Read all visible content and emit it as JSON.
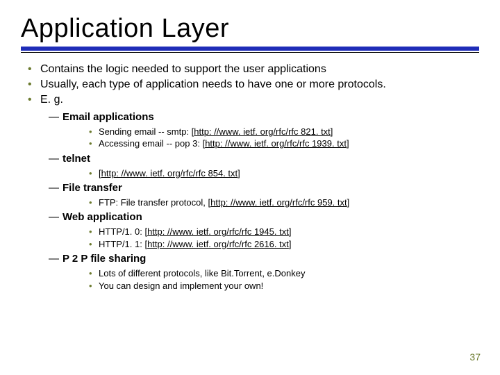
{
  "title": "Application Layer",
  "bullets": [
    "Contains the logic needed to support the user applications",
    "Usually, each type of application needs to have one or more protocols.",
    "E. g."
  ],
  "sections": [
    {
      "heading": "Email applications",
      "items": [
        {
          "prefix": "Sending email -- smtp:  [",
          "link": "http: //www. ietf. org/rfc/rfc 821. txt",
          "suffix": "]"
        },
        {
          "prefix": "Accessing email -- pop 3: [",
          "link": "http: //www. ietf. org/rfc/rfc 1939. txt",
          "suffix": "]"
        }
      ]
    },
    {
      "heading": "telnet",
      "items": [
        {
          "prefix": "[",
          "link": "http: //www. ietf. org/rfc/rfc 854. txt",
          "suffix": "]"
        }
      ]
    },
    {
      "heading": "File transfer",
      "items": [
        {
          "prefix": "FTP: File transfer protocol, [",
          "link": "http: //www. ietf. org/rfc/rfc 959. txt",
          "suffix": "]"
        }
      ]
    },
    {
      "heading": "Web application",
      "items": [
        {
          "prefix": "HTTP/1. 0: [",
          "link": "http: //www. ietf. org/rfc/rfc 1945. txt",
          "suffix": "]"
        },
        {
          "prefix": "HTTP/1. 1: [",
          "link": "http: //www. ietf. org/rfc/rfc 2616. txt",
          "suffix": "]"
        }
      ]
    },
    {
      "heading": "P 2 P file sharing",
      "items": [
        {
          "prefix": "Lots of different protocols, like Bit.Torrent, e.Donkey",
          "link": "",
          "suffix": ""
        },
        {
          "prefix": "You can design and implement your own!",
          "link": "",
          "suffix": ""
        }
      ]
    }
  ],
  "page_number": "37"
}
